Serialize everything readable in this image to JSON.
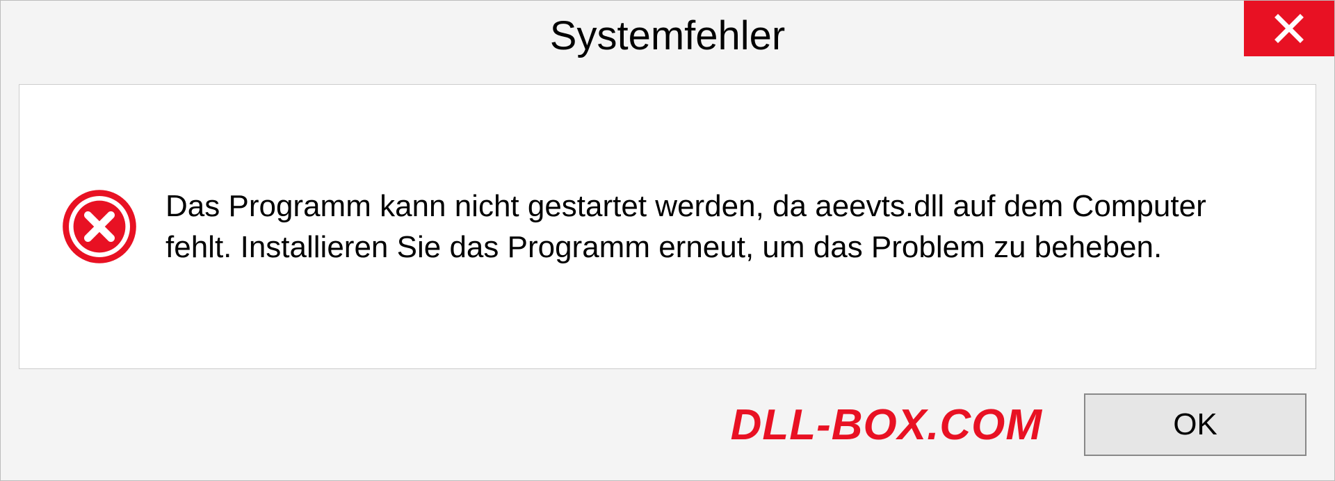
{
  "dialog": {
    "title": "Systemfehler",
    "message": "Das Programm kann nicht gestartet werden, da aeevts.dll auf dem Computer fehlt. Installieren Sie das Programm erneut, um das Problem zu beheben.",
    "ok_label": "OK"
  },
  "watermark": "DLL-BOX.COM",
  "colors": {
    "error_red": "#e81123",
    "background": "#f4f4f4"
  }
}
